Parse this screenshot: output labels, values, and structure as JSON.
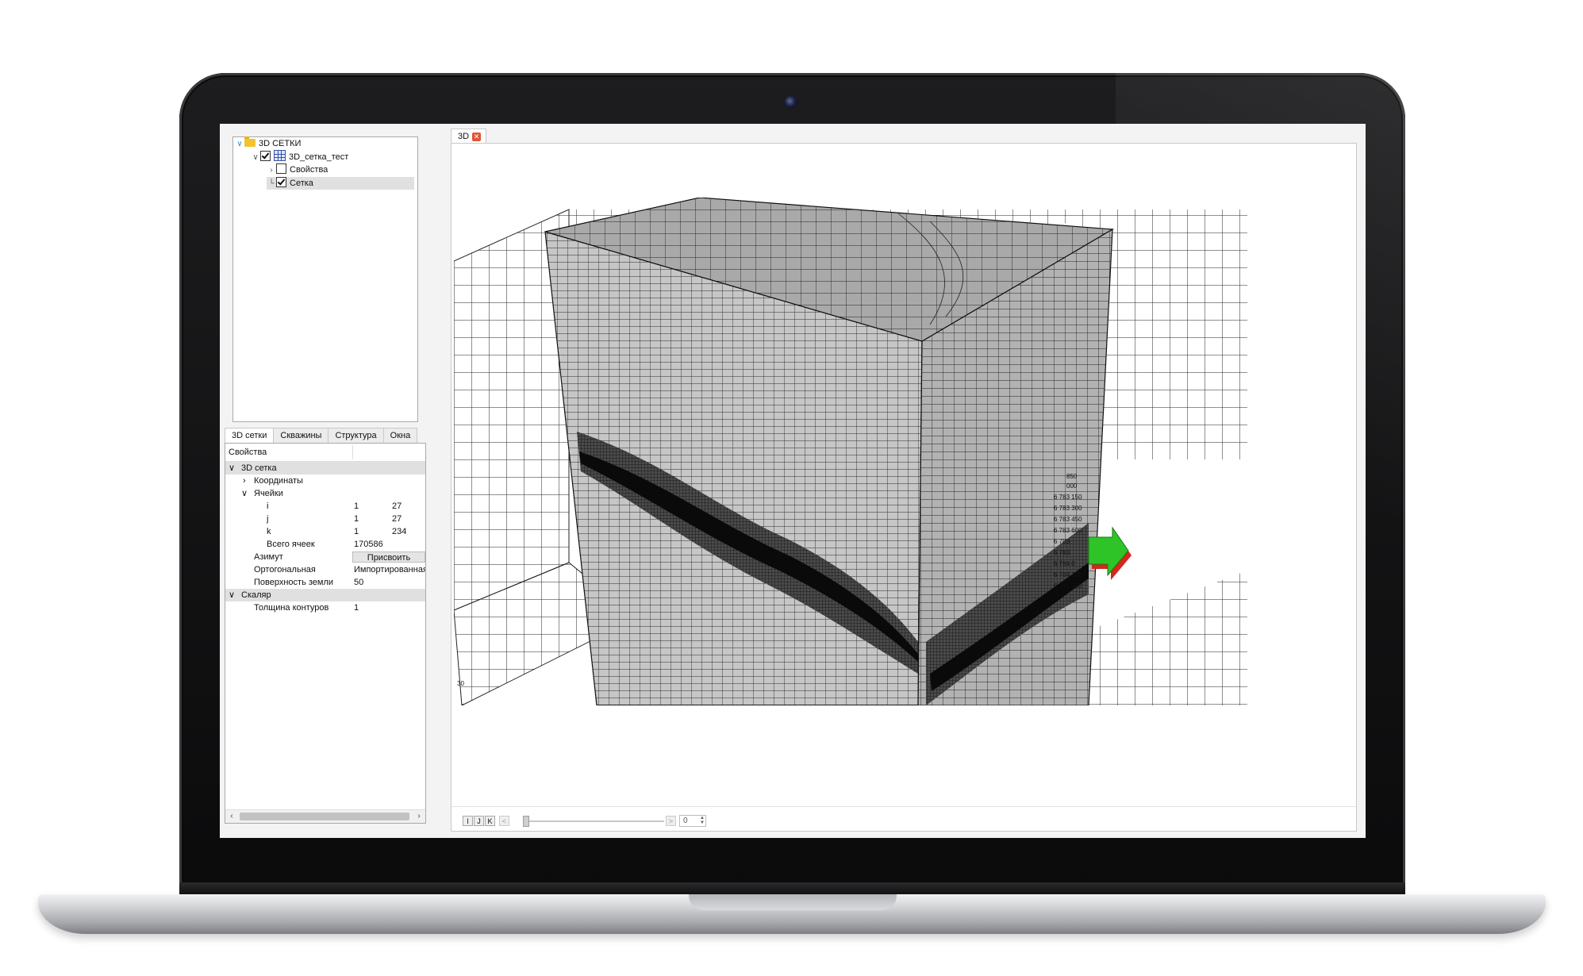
{
  "tree": {
    "root": "3D СЕТКИ",
    "grid": "3D_сетка_тест",
    "properties": "Свойства",
    "mesh": "Сетка"
  },
  "left_tabs": [
    "3D сетки",
    "Скважины",
    "Структура",
    "Окна"
  ],
  "props": {
    "header": "Свойства",
    "group_3d": "3D сетка",
    "coords": "Координаты",
    "cells": "Ячейки",
    "i": {
      "label": "i",
      "from": "1",
      "to": "27"
    },
    "j": {
      "label": "j",
      "from": "1",
      "to": "27"
    },
    "k": {
      "label": "k",
      "from": "1",
      "to": "234"
    },
    "total_label": "Всего ячеек",
    "total_value": "170586",
    "azimuth_label": "Азимут",
    "assign_button": "Присвоить",
    "orthogonal_label": "Ортогональная",
    "orthogonal_value": "Импортированная",
    "surface_label": "Поверхность земли",
    "surface_value": "50",
    "group_scalar": "Скаляр",
    "contour_label": "Толщина контуров",
    "contour_value": "1"
  },
  "view": {
    "tab_label": "3D",
    "axis_left_value": "30",
    "axis_coords": [
      "850",
      "000",
      "6 783 150",
      "6 783 300",
      "6 783 450",
      "6 783 600",
      "6 783",
      "6 783",
      "6 784 0",
      "6 784 200",
      "6 784 350"
    ],
    "bottom": {
      "i": "I",
      "j": "J",
      "k": "K",
      "prev": "<",
      "next": ">",
      "value": "0"
    }
  },
  "colors": {
    "accent_green": "#2ec427",
    "accent_red": "#d3281e",
    "tab_close": "#e05435"
  }
}
